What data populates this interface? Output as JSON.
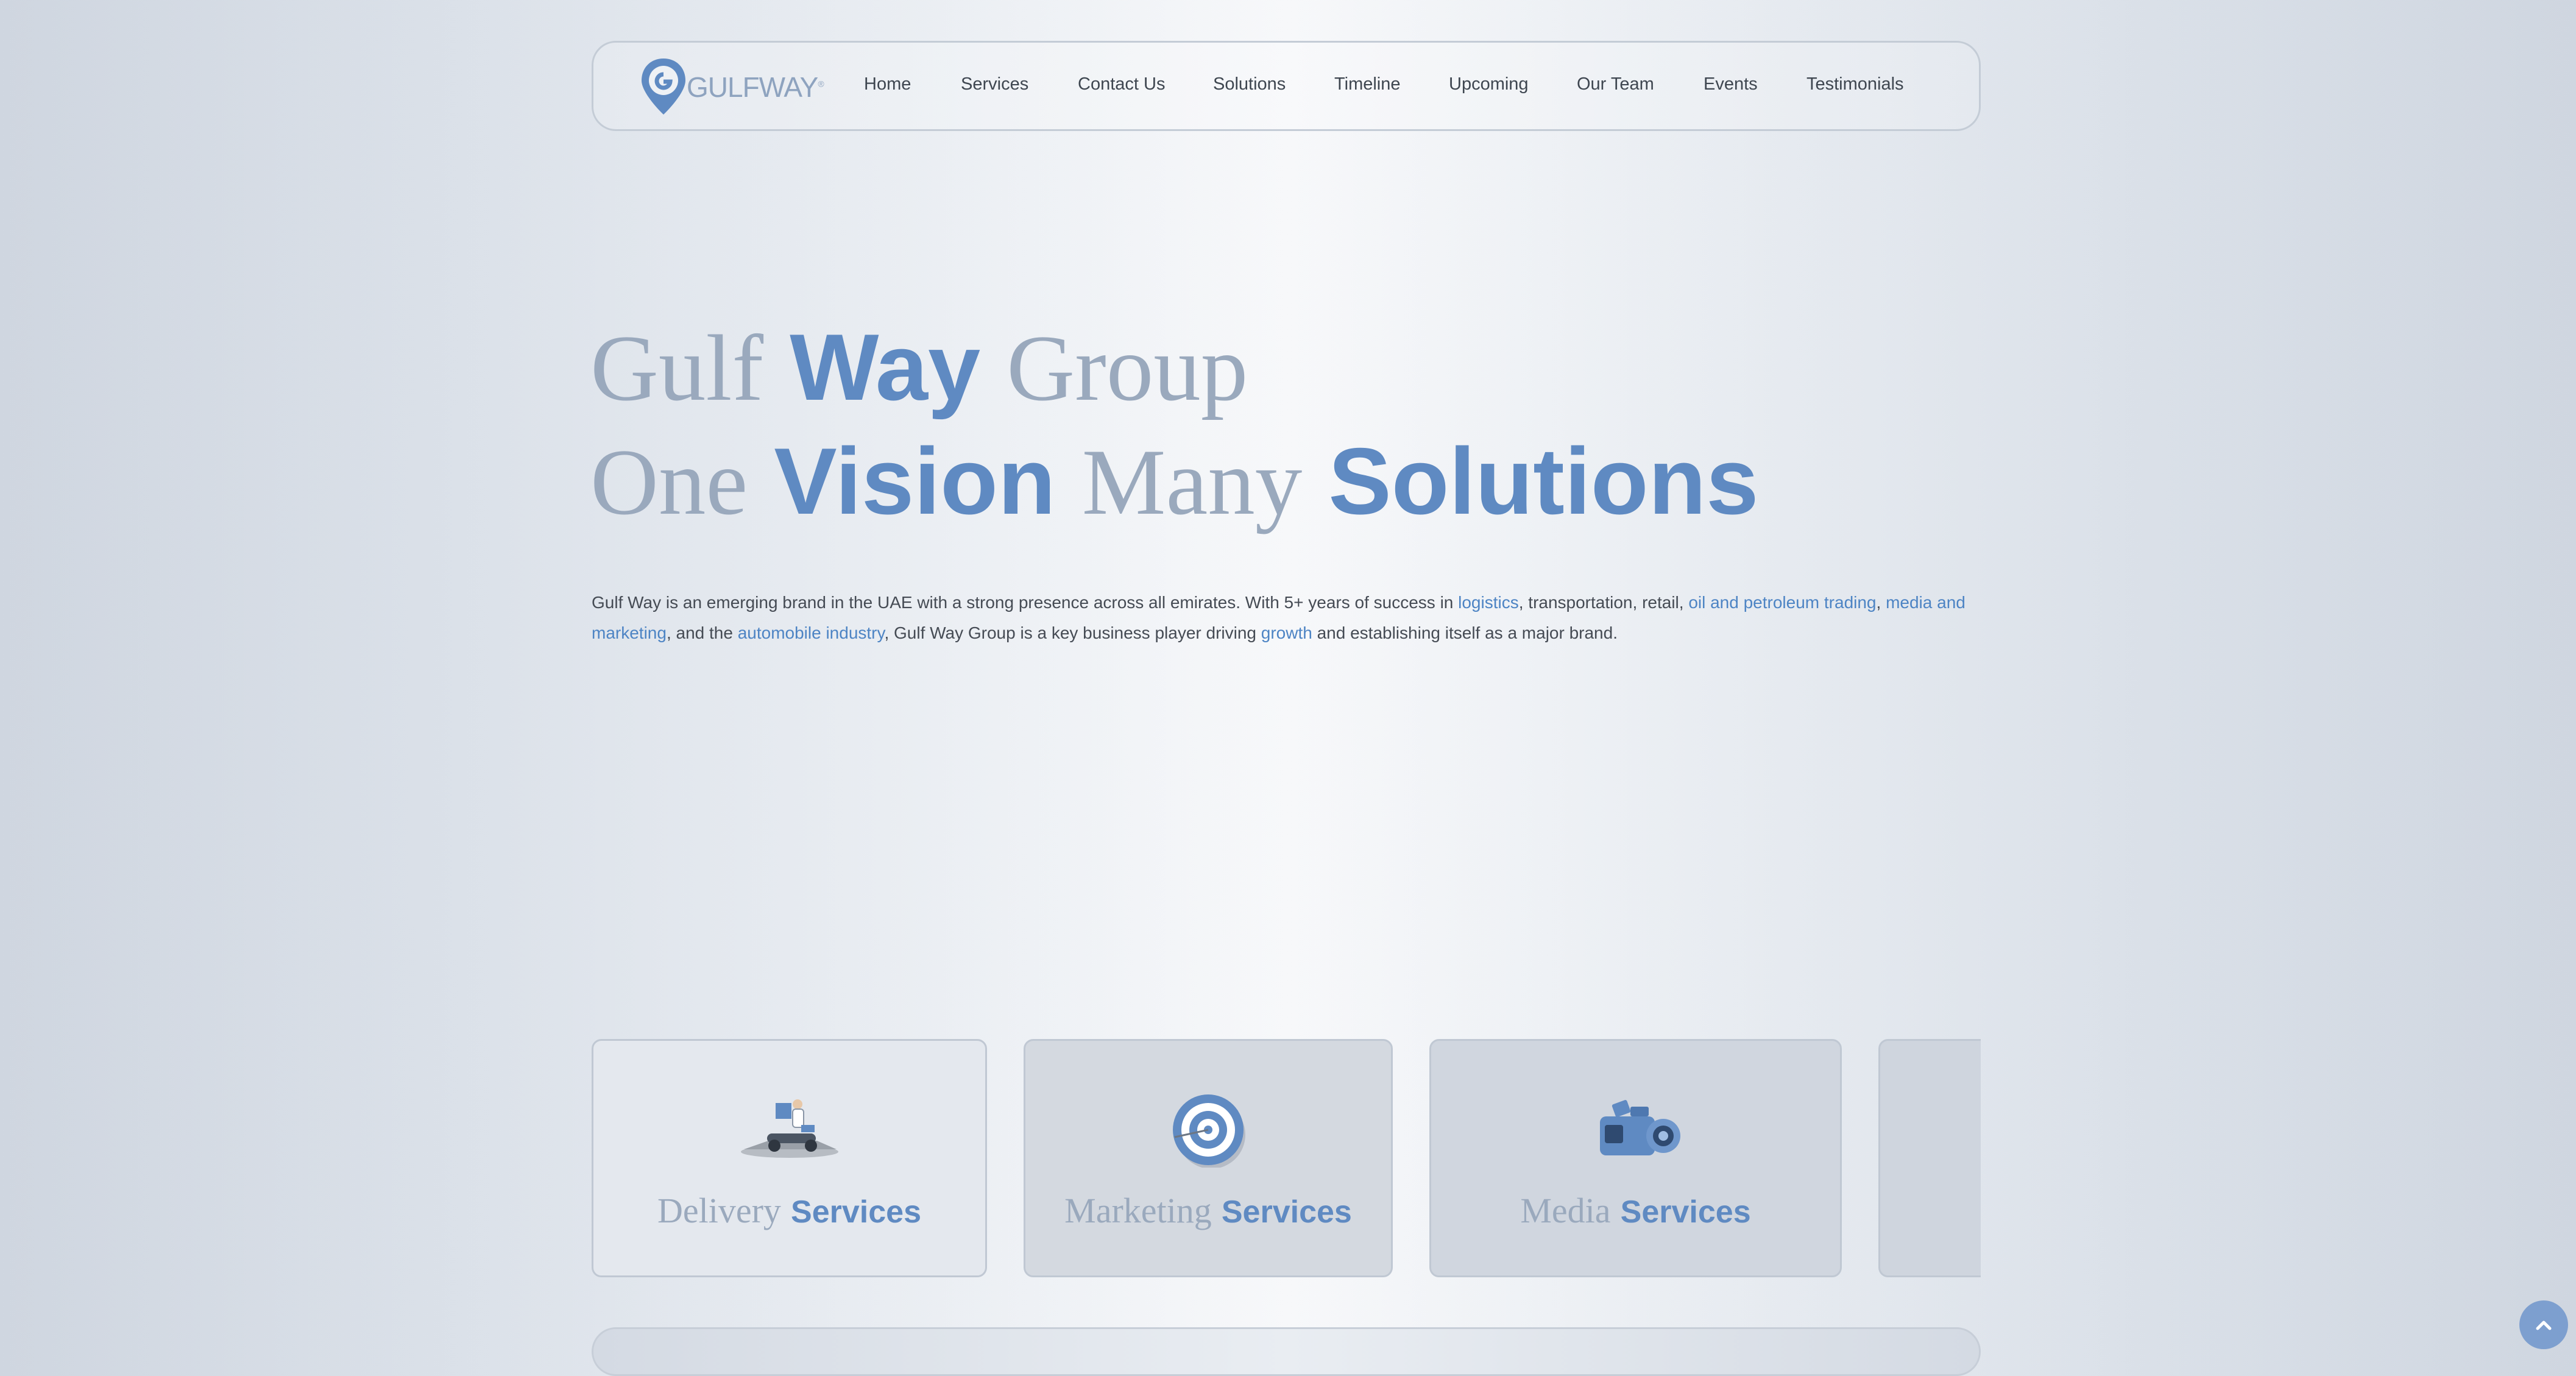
{
  "brand": {
    "name": "GULFWAY",
    "trademark": "®"
  },
  "nav": {
    "items": [
      "Home",
      "Services",
      "Contact Us",
      "Solutions",
      "Timeline",
      "Upcoming",
      "Our Team",
      "Events",
      "Testimonials"
    ]
  },
  "hero": {
    "line1": {
      "part1": "Gulf",
      "part2": "Way",
      "part3": "Group"
    },
    "line2": {
      "part1": "One",
      "part2": "Vision",
      "part3": "Many",
      "part4": "Solutions"
    }
  },
  "intro": {
    "t1": "Gulf Way is an emerging brand in the UAE with a strong presence across all emirates. With 5+ years of success in ",
    "l1": "logistics",
    "t2": ", transportation, retail, ",
    "l2": "oil and petroleum trading",
    "t3": ", ",
    "l3": "media and marketing",
    "t4": ", and the ",
    "l4": "automobile industry",
    "t5": ", Gulf Way Group is a key business player driving ",
    "l5": "growth",
    "t6": " and establishing itself as a major brand."
  },
  "services": [
    {
      "word": "Delivery",
      "suffix": "Services",
      "icon": "delivery-scooter-icon"
    },
    {
      "word": "Marketing",
      "suffix": "Services",
      "icon": "target-icon"
    },
    {
      "word": "Media",
      "suffix": "Services",
      "icon": "video-camera-icon"
    },
    {
      "word": "",
      "suffix": "",
      "icon": ""
    }
  ],
  "colors": {
    "accent": "#5f8ac2",
    "muted_serif": "#9aa9bd",
    "link": "#4d84c4",
    "text": "#454b54"
  },
  "scroll_top": {
    "icon": "chevron-up-icon"
  }
}
